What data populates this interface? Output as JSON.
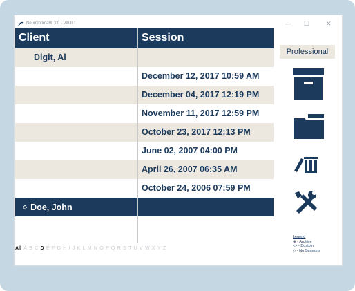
{
  "window": {
    "title": "NeurOptimal® 3.0 - VAULT",
    "controls": {
      "minimize": "—",
      "maximize": "☐",
      "close": "✕"
    }
  },
  "grid": {
    "columns": [
      "Client",
      "Session"
    ],
    "rows": [
      {
        "client": "Digit, Al",
        "session": "",
        "style": "shade",
        "group": true
      },
      {
        "client": "",
        "session": "December 12, 2017 10:59 AM",
        "style": "white"
      },
      {
        "client": "",
        "session": "December 04, 2017 12:19 PM",
        "style": "shade"
      },
      {
        "client": "",
        "session": "November 11, 2017 12:59 PM",
        "style": "white"
      },
      {
        "client": "",
        "session": "October 23, 2017 12:13 PM",
        "style": "shade"
      },
      {
        "client": "",
        "session": "June 02, 2007 04:00 PM",
        "style": "white"
      },
      {
        "client": "",
        "session": "April 26, 2007 06:35 AM",
        "style": "shade"
      },
      {
        "client": "",
        "session": "October 24, 2006 07:59 PM",
        "style": "white"
      },
      {
        "client": "Doe, John",
        "session": "",
        "style": "selected",
        "group": true,
        "marker": "◇"
      }
    ]
  },
  "alphabet": {
    "letters": [
      "All",
      "A",
      "B",
      "C",
      "D",
      "E",
      "F",
      "G",
      "H",
      "I",
      "J",
      "K",
      "L",
      "M",
      "N",
      "O",
      "P",
      "Q",
      "R",
      "S",
      "T",
      "U",
      "V",
      "W",
      "X",
      "Y",
      "Z"
    ],
    "active": [
      "All",
      "D"
    ]
  },
  "side_panel": {
    "professional_label": "Professional",
    "icons": [
      "archive-icon",
      "folder-icon",
      "dustbin-icon",
      "tools-icon"
    ]
  },
  "legend": {
    "title": "Legend",
    "items": [
      {
        "symbol": "⊕",
        "label": "- Archive"
      },
      {
        "symbol": "<>",
        "label": "- Dustbin"
      },
      {
        "symbol": "◇",
        "label": "- No Sessions"
      }
    ]
  },
  "colors": {
    "header_bg": "#1b3a5c",
    "row_shade": "#ece8df",
    "frame_bg": "#c5d7e2"
  }
}
